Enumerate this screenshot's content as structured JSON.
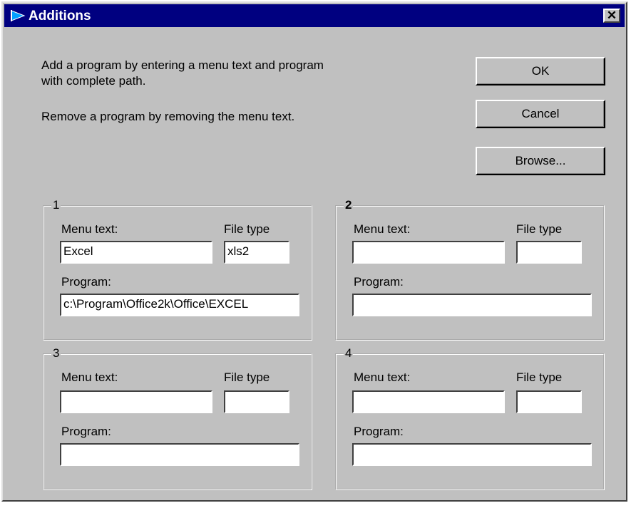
{
  "window": {
    "title": "Additions",
    "close_glyph": "✕",
    "title_bar_color": "#000080",
    "face_color": "#c0c0c0"
  },
  "instructions": {
    "line1": "Add a program by entering a menu text and program",
    "line2": "with complete path.",
    "line3": "Remove a program by removing the menu text."
  },
  "buttons": {
    "ok": "OK",
    "cancel": "Cancel",
    "browse": "Browse..."
  },
  "groups": [
    {
      "title": "1",
      "menu_text_label": "Menu text:",
      "file_type_label": "File type",
      "program_label": "Program:",
      "menu_text_value": "Excel",
      "file_type_value": "xls2",
      "program_value": "c:\\Program\\Office2k\\Office\\EXCEL"
    },
    {
      "title": "2",
      "menu_text_label": "Menu text:",
      "file_type_label": "File type",
      "program_label": "Program:",
      "menu_text_value": "",
      "file_type_value": "",
      "program_value": ""
    },
    {
      "title": "3",
      "menu_text_label": "Menu text:",
      "file_type_label": "File type",
      "program_label": "Program:",
      "menu_text_value": "",
      "file_type_value": "",
      "program_value": ""
    },
    {
      "title": "4",
      "menu_text_label": "Menu text:",
      "file_type_label": "File type",
      "program_label": "Program:",
      "menu_text_value": "",
      "file_type_value": "",
      "program_value": ""
    }
  ]
}
